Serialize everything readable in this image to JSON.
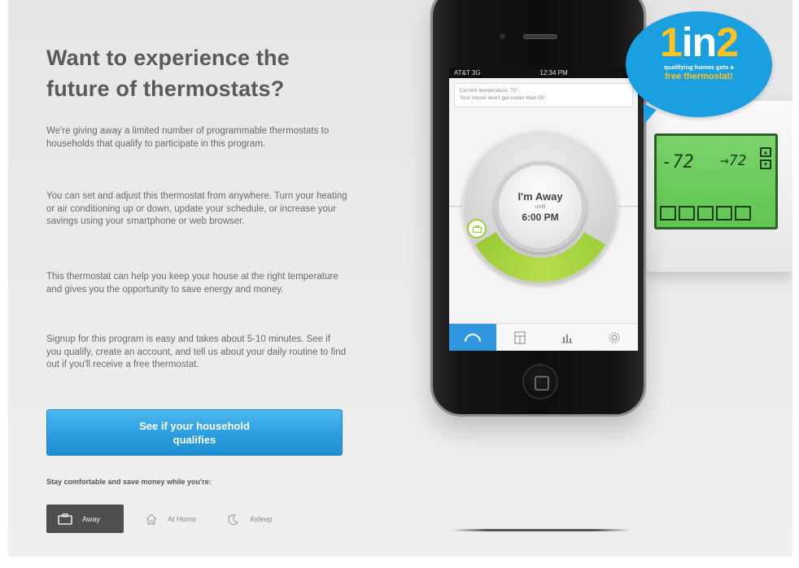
{
  "headline": "Want to experience the future of thermostats?",
  "paragraphs": [
    "We're giving away a limited number of programmable thermostats to households that qualify to participate in this program.",
    "You can set and adjust this thermostat from anywhere. Turn your heating or air conditioning up or down, update your schedule, or increase your savings using your smartphone or web browser.",
    "This thermostat can help you keep your house at the right temperature and gives you the opportunity to save energy and money.",
    "Signup for this program is easy and takes about 5-10 minutes. See if you qualify, create an account, and tell us about your daily routine to find out if you'll receive a free thermostat."
  ],
  "cta": {
    "label": "See if your household qualifies"
  },
  "comfort_label": "Stay comfortable and save money while you're:",
  "modes": [
    {
      "label": "Away",
      "icon": "briefcase-icon",
      "active": true
    },
    {
      "label": "At Home",
      "icon": "house-icon",
      "active": false
    },
    {
      "label": "Asleep",
      "icon": "moon-icon",
      "active": false
    }
  ],
  "phone": {
    "status": {
      "carrier": "AT&T 3G",
      "time": "12:34 PM"
    },
    "info_line1": "Current temperature: 73°.",
    "info_line2": "Your house won't get cooler than 55°.",
    "dial": {
      "mode": "I'm Away",
      "until": "until",
      "time": "6:00 PM"
    },
    "tabs": [
      "dial-icon",
      "schedule-icon",
      "chart-icon",
      "gear-icon"
    ]
  },
  "device": {
    "current": "72",
    "setpoint": "72"
  },
  "bubble": {
    "num1": "1",
    "word": "in",
    "num2": "2",
    "line1": "qualifying homes gets a",
    "line2": "free thermostat!"
  },
  "colors": {
    "accent": "#2b9ee0",
    "green": "#9fcf3c",
    "yellow": "#ffc21f",
    "text": "#6b6b6b"
  }
}
